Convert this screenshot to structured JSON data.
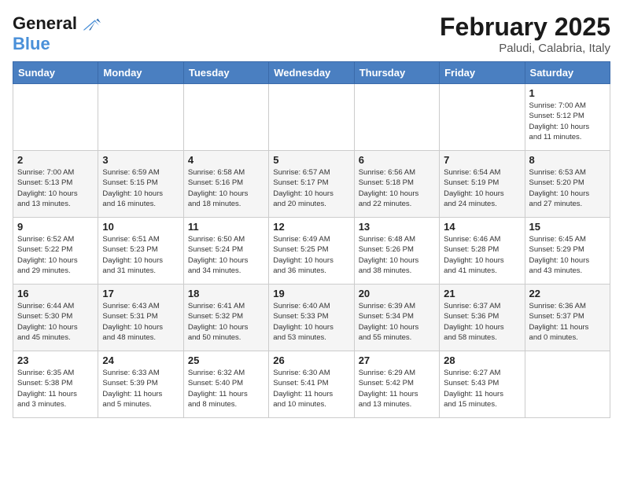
{
  "header": {
    "logo_line1": "General",
    "logo_line2": "Blue",
    "month": "February 2025",
    "location": "Paludi, Calabria, Italy"
  },
  "weekdays": [
    "Sunday",
    "Monday",
    "Tuesday",
    "Wednesday",
    "Thursday",
    "Friday",
    "Saturday"
  ],
  "weeks": [
    [
      {
        "day": "",
        "info": ""
      },
      {
        "day": "",
        "info": ""
      },
      {
        "day": "",
        "info": ""
      },
      {
        "day": "",
        "info": ""
      },
      {
        "day": "",
        "info": ""
      },
      {
        "day": "",
        "info": ""
      },
      {
        "day": "1",
        "info": "Sunrise: 7:00 AM\nSunset: 5:12 PM\nDaylight: 10 hours\nand 11 minutes."
      }
    ],
    [
      {
        "day": "2",
        "info": "Sunrise: 7:00 AM\nSunset: 5:13 PM\nDaylight: 10 hours\nand 13 minutes."
      },
      {
        "day": "3",
        "info": "Sunrise: 6:59 AM\nSunset: 5:15 PM\nDaylight: 10 hours\nand 16 minutes."
      },
      {
        "day": "4",
        "info": "Sunrise: 6:58 AM\nSunset: 5:16 PM\nDaylight: 10 hours\nand 18 minutes."
      },
      {
        "day": "5",
        "info": "Sunrise: 6:57 AM\nSunset: 5:17 PM\nDaylight: 10 hours\nand 20 minutes."
      },
      {
        "day": "6",
        "info": "Sunrise: 6:56 AM\nSunset: 5:18 PM\nDaylight: 10 hours\nand 22 minutes."
      },
      {
        "day": "7",
        "info": "Sunrise: 6:54 AM\nSunset: 5:19 PM\nDaylight: 10 hours\nand 24 minutes."
      },
      {
        "day": "8",
        "info": "Sunrise: 6:53 AM\nSunset: 5:20 PM\nDaylight: 10 hours\nand 27 minutes."
      }
    ],
    [
      {
        "day": "9",
        "info": "Sunrise: 6:52 AM\nSunset: 5:22 PM\nDaylight: 10 hours\nand 29 minutes."
      },
      {
        "day": "10",
        "info": "Sunrise: 6:51 AM\nSunset: 5:23 PM\nDaylight: 10 hours\nand 31 minutes."
      },
      {
        "day": "11",
        "info": "Sunrise: 6:50 AM\nSunset: 5:24 PM\nDaylight: 10 hours\nand 34 minutes."
      },
      {
        "day": "12",
        "info": "Sunrise: 6:49 AM\nSunset: 5:25 PM\nDaylight: 10 hours\nand 36 minutes."
      },
      {
        "day": "13",
        "info": "Sunrise: 6:48 AM\nSunset: 5:26 PM\nDaylight: 10 hours\nand 38 minutes."
      },
      {
        "day": "14",
        "info": "Sunrise: 6:46 AM\nSunset: 5:28 PM\nDaylight: 10 hours\nand 41 minutes."
      },
      {
        "day": "15",
        "info": "Sunrise: 6:45 AM\nSunset: 5:29 PM\nDaylight: 10 hours\nand 43 minutes."
      }
    ],
    [
      {
        "day": "16",
        "info": "Sunrise: 6:44 AM\nSunset: 5:30 PM\nDaylight: 10 hours\nand 45 minutes."
      },
      {
        "day": "17",
        "info": "Sunrise: 6:43 AM\nSunset: 5:31 PM\nDaylight: 10 hours\nand 48 minutes."
      },
      {
        "day": "18",
        "info": "Sunrise: 6:41 AM\nSunset: 5:32 PM\nDaylight: 10 hours\nand 50 minutes."
      },
      {
        "day": "19",
        "info": "Sunrise: 6:40 AM\nSunset: 5:33 PM\nDaylight: 10 hours\nand 53 minutes."
      },
      {
        "day": "20",
        "info": "Sunrise: 6:39 AM\nSunset: 5:34 PM\nDaylight: 10 hours\nand 55 minutes."
      },
      {
        "day": "21",
        "info": "Sunrise: 6:37 AM\nSunset: 5:36 PM\nDaylight: 10 hours\nand 58 minutes."
      },
      {
        "day": "22",
        "info": "Sunrise: 6:36 AM\nSunset: 5:37 PM\nDaylight: 11 hours\nand 0 minutes."
      }
    ],
    [
      {
        "day": "23",
        "info": "Sunrise: 6:35 AM\nSunset: 5:38 PM\nDaylight: 11 hours\nand 3 minutes."
      },
      {
        "day": "24",
        "info": "Sunrise: 6:33 AM\nSunset: 5:39 PM\nDaylight: 11 hours\nand 5 minutes."
      },
      {
        "day": "25",
        "info": "Sunrise: 6:32 AM\nSunset: 5:40 PM\nDaylight: 11 hours\nand 8 minutes."
      },
      {
        "day": "26",
        "info": "Sunrise: 6:30 AM\nSunset: 5:41 PM\nDaylight: 11 hours\nand 10 minutes."
      },
      {
        "day": "27",
        "info": "Sunrise: 6:29 AM\nSunset: 5:42 PM\nDaylight: 11 hours\nand 13 minutes."
      },
      {
        "day": "28",
        "info": "Sunrise: 6:27 AM\nSunset: 5:43 PM\nDaylight: 11 hours\nand 15 minutes."
      },
      {
        "day": "",
        "info": ""
      }
    ]
  ]
}
